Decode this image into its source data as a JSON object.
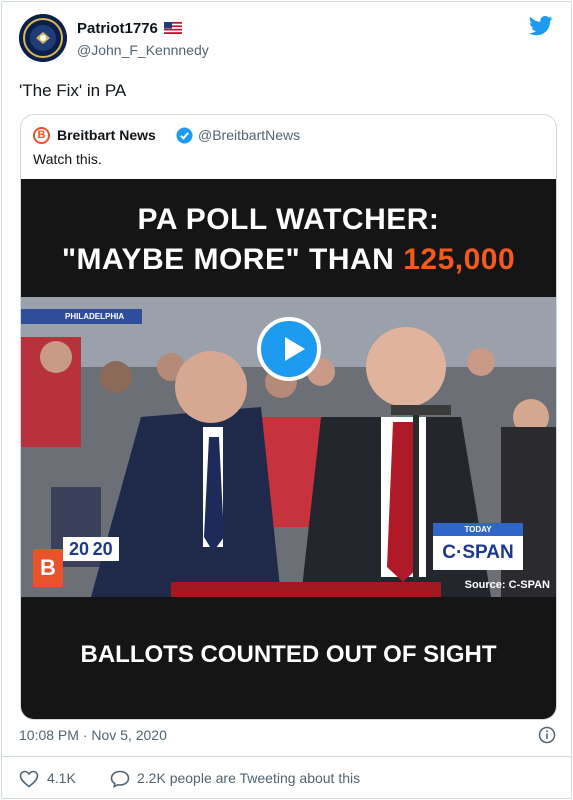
{
  "tweet": {
    "display_name": "Patriot1776",
    "handle": "@John_F_Kennnedy",
    "text": "'The Fix' in PA",
    "timestamp": "10:08 PM · Nov 5, 2020",
    "likes": "4.1K",
    "replies_text": "2.2K people are Tweeting about this"
  },
  "quoted": {
    "name": "Breitbart News",
    "handle": "@BreitbartNews",
    "text": "Watch this.",
    "logo_letter": "B"
  },
  "video": {
    "headline_line1": "PA POLL WATCHER:",
    "headline_line2_prefix": "\"MAYBE MORE\" THAN",
    "headline_line2_highlight": "125,000",
    "location_badge": "PHILADELPHIA",
    "network_today": "TODAY",
    "network_logo": "C·SPAN",
    "source": "Source: C-SPAN",
    "year_badge": "20 20",
    "corner_letter": "B",
    "caption": "BALLOTS COUNTED OUT OF SIGHT"
  },
  "colors": {
    "twitter_blue": "#1d9bf0",
    "breitbart_orange": "#e8532b",
    "headline_highlight": "#f25a1f",
    "cspan_blue": "#1b3a8c"
  }
}
